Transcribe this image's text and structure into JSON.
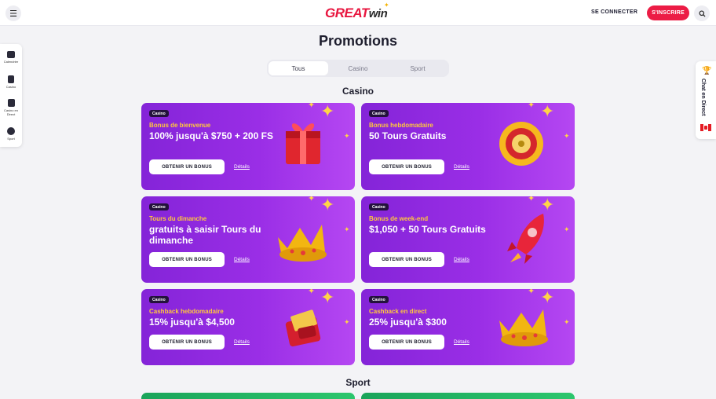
{
  "header": {
    "logo_great": "GREAT",
    "logo_win": "win",
    "signin_label": "SE CONNECTER",
    "signup_label": "S'INSCRIRE"
  },
  "left_sidebar": {
    "items": [
      {
        "label": "Calendrier",
        "icon": "calendar-icon"
      },
      {
        "label": "Casino",
        "icon": "slot-machine-icon"
      },
      {
        "label": "Casino en Direct",
        "icon": "live-casino-icon"
      },
      {
        "label": "Sport",
        "icon": "soccer-ball-icon"
      }
    ]
  },
  "right_sidebar": {
    "chat_label": "Chat en Direct",
    "trophy_icon": "trophy-icon",
    "flag_icon": "canada-flag-icon"
  },
  "page": {
    "title": "Promotions",
    "tabs": [
      {
        "label": "Tous",
        "active": true
      },
      {
        "label": "Casino",
        "active": false
      },
      {
        "label": "Sport",
        "active": false
      }
    ],
    "casino_section_title": "Casino",
    "sport_section_title": "Sport"
  },
  "cards": [
    {
      "tag": "Casino",
      "subtitle": "Bonus de bienvenue",
      "headline": "100% jusqu'à $750 + 200 FS",
      "cta": "OBTENIR UN BONUS",
      "details": "Détails",
      "image": "gift-box"
    },
    {
      "tag": "Casino",
      "subtitle": "Bonus hebdomadaire",
      "headline": "50 Tours Gratuits",
      "cta": "OBTENIR UN BONUS",
      "details": "Détails",
      "image": "roulette-wheel"
    },
    {
      "tag": "Casino",
      "subtitle": "Tours du dimanche",
      "headline": "gratuits à saisir Tours du dimanche",
      "cta": "OBTENIR UN BONUS",
      "details": "Détails",
      "image": "crown"
    },
    {
      "tag": "Casino",
      "subtitle": "Bonus de week-end",
      "headline": "$1,050 + 50 Tours Gratuits",
      "cta": "OBTENIR UN BONUS",
      "details": "Détails",
      "image": "rocket"
    },
    {
      "tag": "Casino",
      "subtitle": "Cashback hebdomadaire",
      "headline": "15% jusqu'à $4,500",
      "cta": "OBTENIR UN BONUS",
      "details": "Détails",
      "image": "wallet"
    },
    {
      "tag": "Casino",
      "subtitle": "Cashback en direct",
      "headline": "25% jusqu'à $300",
      "cta": "OBTENIR UN BONUS",
      "details": "Détails",
      "image": "crown"
    }
  ],
  "colors": {
    "brand_red": "#ec1c45",
    "card_purple": "#9a2ee6",
    "subtitle_yellow": "#ffc93c",
    "sport_green": "#2cc66d"
  }
}
